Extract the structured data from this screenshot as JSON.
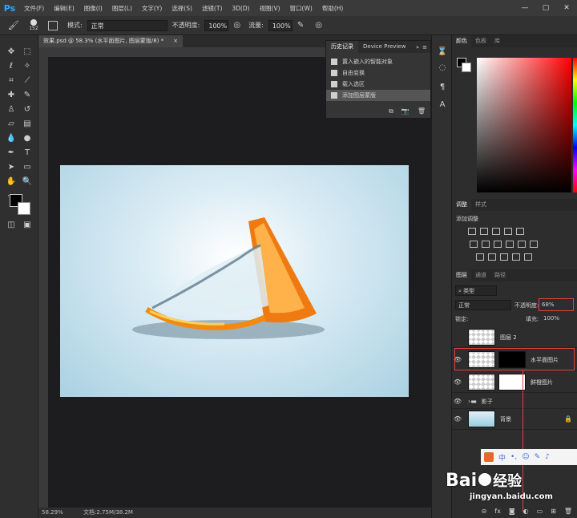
{
  "app": {
    "logo": "Ps"
  },
  "menu": [
    "文件(F)",
    "编辑(E)",
    "图像(I)",
    "图层(L)",
    "文字(Y)",
    "选择(S)",
    "滤镜(T)",
    "3D(D)",
    "视图(V)",
    "窗口(W)",
    "帮助(H)"
  ],
  "window_buttons": {
    "min": "—",
    "max": "▢",
    "close": "✕"
  },
  "options": {
    "brush_size": "152",
    "mode_label": "模式:",
    "mode_value": "正常",
    "opacity_label": "不透明度:",
    "opacity_value": "100%",
    "flow_label": "流量:",
    "flow_value": "100%"
  },
  "document": {
    "tab_title": "效果.psd @ 58.3% (水平面图片, 图层蒙版/8) *",
    "close": "×",
    "zoom": "58.29%",
    "doc_info": "文档:2.75M/38.2M"
  },
  "history": {
    "tabs": [
      "历史记录",
      "Device Preview"
    ],
    "items": [
      "置入嵌入的智能对象",
      "自由变换",
      "载入选区",
      "添加图层蒙版"
    ],
    "selected_index": 3
  },
  "color_panel": {
    "tabs": [
      "颜色",
      "色板",
      "库"
    ]
  },
  "adjust_panel": {
    "tabs": [
      "调整",
      "样式"
    ],
    "title": "添加调整"
  },
  "layers_panel": {
    "tabs": [
      "图层",
      "通道",
      "路径"
    ],
    "filter_kind": "类型",
    "blend_mode": "正常",
    "opacity_label": "不透明度:",
    "opacity_value": "68%",
    "lock_label": "锁定:",
    "fill_label": "填充:",
    "fill_value": "100%",
    "layers": [
      {
        "name": "图层 2",
        "visible": false
      },
      {
        "name": "水平面图片",
        "visible": true
      },
      {
        "name": "鲜橙图片",
        "visible": true
      },
      {
        "name": "影子",
        "visible": true,
        "group": true
      },
      {
        "name": "背景",
        "visible": true
      }
    ]
  },
  "ime": {
    "label": "中"
  },
  "watermark": {
    "brand": "Bai",
    "brand2": "经验",
    "url": "jingyan.baidu.com"
  }
}
